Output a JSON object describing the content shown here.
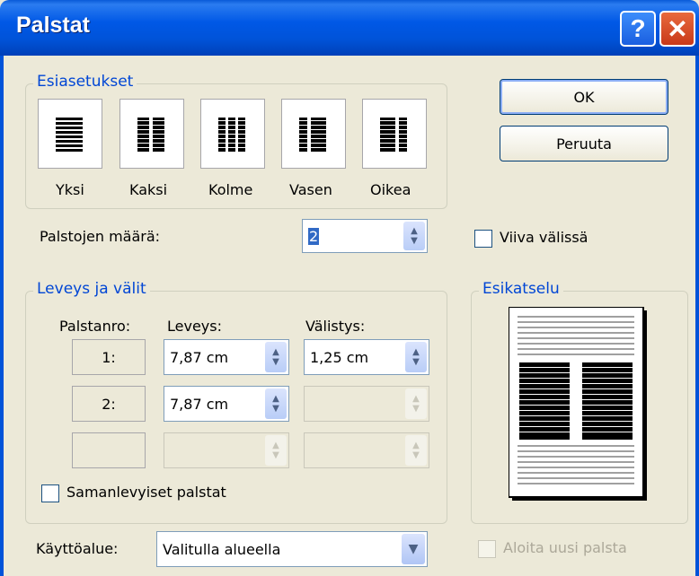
{
  "window": {
    "title": "Palstat",
    "help_label": "?",
    "close_label": "✕"
  },
  "presets": {
    "legend": "Esiasetukset",
    "items": [
      {
        "label": "Yksi",
        "icon": "one-column-icon"
      },
      {
        "label": "Kaksi",
        "icon": "two-columns-icon"
      },
      {
        "label": "Kolme",
        "icon": "three-columns-icon"
      },
      {
        "label": "Vasen",
        "icon": "left-columns-icon"
      },
      {
        "label": "Oikea",
        "icon": "right-columns-icon"
      }
    ]
  },
  "buttons": {
    "ok": "OK",
    "cancel": "Peruuta"
  },
  "column_count": {
    "label": "Palstojen määrä:",
    "value": "2"
  },
  "line_between": {
    "label": "Viiva välissä",
    "checked": false
  },
  "width_spacing": {
    "legend": "Leveys ja välit",
    "headers": {
      "col_num": "Palstanro:",
      "width": "Leveys:",
      "spacing": "Välistys:"
    },
    "rows": [
      {
        "num": "1:",
        "width": "7,87 cm",
        "spacing": "1,25 cm"
      },
      {
        "num": "2:",
        "width": "7,87 cm",
        "spacing": ""
      },
      {
        "num": "",
        "width": "",
        "spacing": ""
      }
    ],
    "equal_width": {
      "label": "Samanlevyiset palstat",
      "checked": false
    }
  },
  "preview": {
    "legend": "Esikatselu"
  },
  "apply_to": {
    "label": "Käyttöalue:",
    "value": "Valitulla alueella"
  },
  "new_column": {
    "label": "Aloita uusi palsta",
    "checked": false,
    "enabled": false
  },
  "colors": {
    "titlebar": "#0053d9",
    "legend": "#0046d5",
    "face": "#ece9d8"
  }
}
